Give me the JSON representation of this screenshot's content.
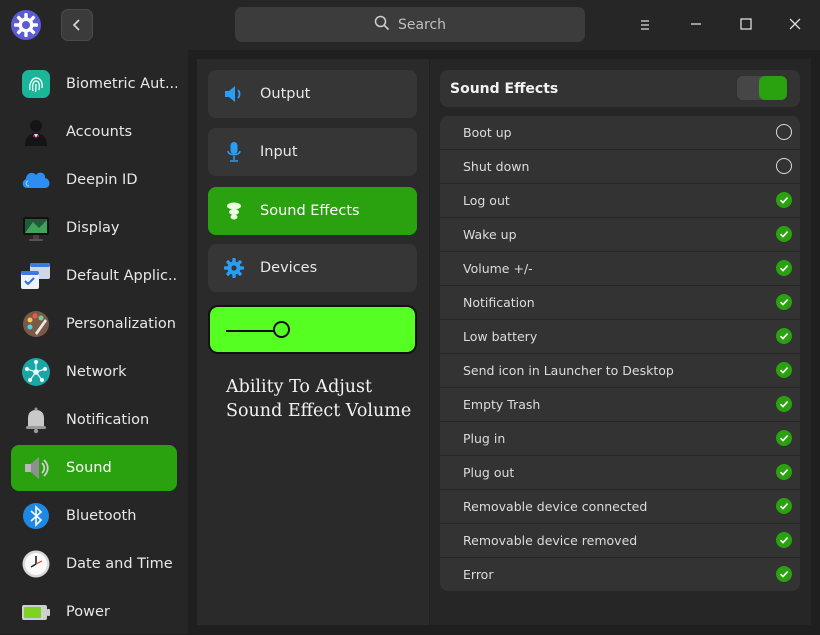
{
  "titlebar": {
    "search_placeholder": "Search"
  },
  "sidebar": {
    "items": [
      {
        "label": "Biometric Aut...",
        "icon": "fingerprint-icon"
      },
      {
        "label": "Accounts",
        "icon": "user-account-icon"
      },
      {
        "label": "Deepin ID",
        "icon": "cloud-icon"
      },
      {
        "label": "Display",
        "icon": "monitor-icon"
      },
      {
        "label": "Default Applic...",
        "icon": "default-apps-icon"
      },
      {
        "label": "Personalization",
        "icon": "palette-icon"
      },
      {
        "label": "Network",
        "icon": "network-icon"
      },
      {
        "label": "Notification",
        "icon": "bell-icon"
      },
      {
        "label": "Sound",
        "icon": "speaker-icon"
      },
      {
        "label": "Bluetooth",
        "icon": "bluetooth-icon"
      },
      {
        "label": "Date and Time",
        "icon": "clock-icon"
      },
      {
        "label": "Power",
        "icon": "battery-icon"
      }
    ],
    "active": "Sound"
  },
  "sound_nav": {
    "items": [
      {
        "label": "Output",
        "icon": "speaker-output-icon"
      },
      {
        "label": "Input",
        "icon": "microphone-icon"
      },
      {
        "label": "Sound Effects",
        "icon": "sound-effects-icon"
      },
      {
        "label": "Devices",
        "icon": "gear-icon"
      }
    ],
    "active": "Sound Effects"
  },
  "volume_slider": {
    "level": 0.8
  },
  "annotation": {
    "text": "Ability To Adjust Sound Effect Volume"
  },
  "sound_effects": {
    "title": "Sound Effects",
    "enabled": true,
    "items": [
      {
        "label": "Boot up",
        "checked": false
      },
      {
        "label": "Shut down",
        "checked": false
      },
      {
        "label": "Log out",
        "checked": true
      },
      {
        "label": "Wake up",
        "checked": true
      },
      {
        "label": "Volume +/-",
        "checked": true
      },
      {
        "label": "Notification",
        "checked": true
      },
      {
        "label": "Low battery",
        "checked": true
      },
      {
        "label": "Send icon in Launcher to Desktop",
        "checked": true
      },
      {
        "label": "Empty Trash",
        "checked": true
      },
      {
        "label": "Plug in",
        "checked": true
      },
      {
        "label": "Plug out",
        "checked": true
      },
      {
        "label": "Removable device connected",
        "checked": true
      },
      {
        "label": "Removable device removed",
        "checked": true
      },
      {
        "label": "Error",
        "checked": true
      }
    ]
  },
  "colors": {
    "accent": "#2aa10f",
    "annotation_box": "#55ff22"
  }
}
